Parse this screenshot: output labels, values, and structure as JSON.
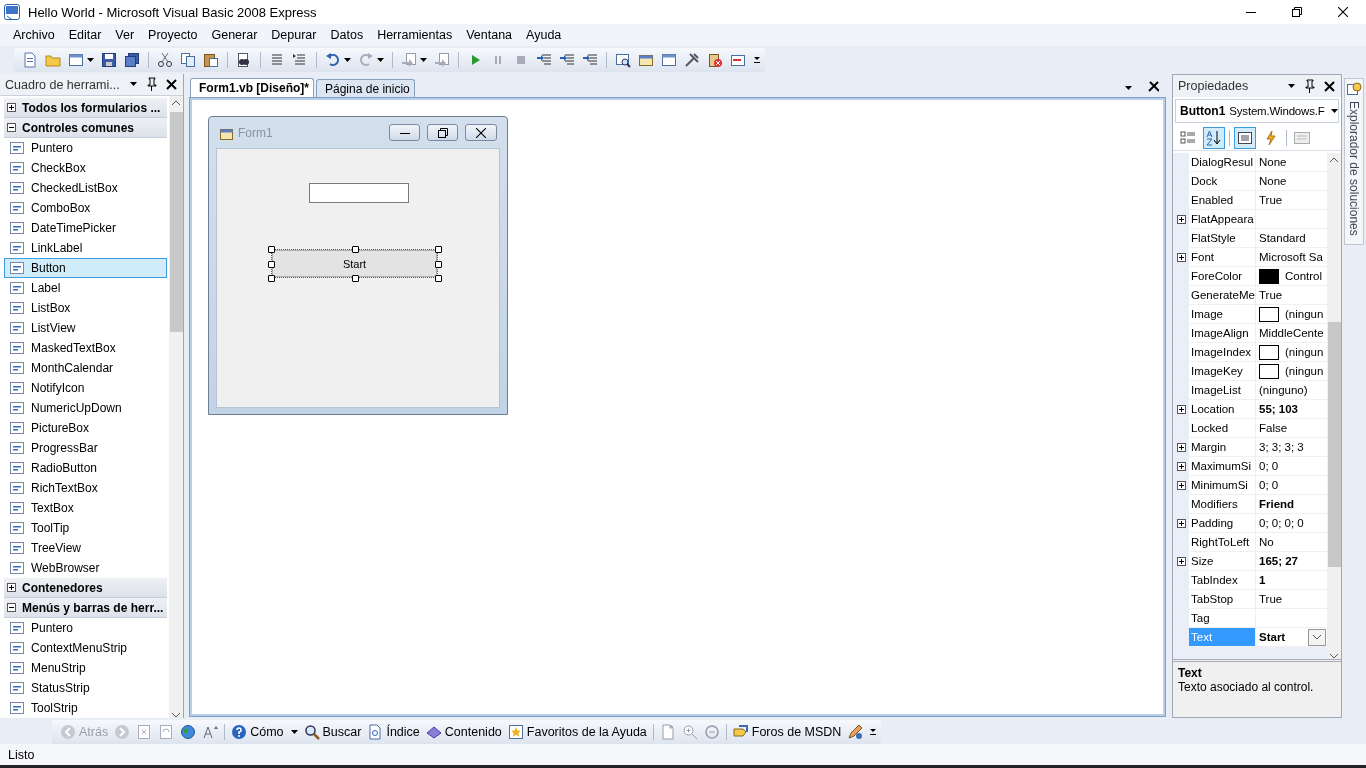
{
  "window": {
    "title": "Hello World - Microsoft Visual Basic 2008 Express"
  },
  "menu": [
    "Archivo",
    "Editar",
    "Ver",
    "Proyecto",
    "Generar",
    "Depurar",
    "Datos",
    "Herramientas",
    "Ventana",
    "Ayuda"
  ],
  "toolbox": {
    "title": "Cuadro de herrami...",
    "groups": [
      {
        "label": "Todos los formularios ...",
        "expanded": false
      },
      {
        "label": "Controles comunes",
        "expanded": true,
        "items": [
          {
            "label": "Puntero",
            "selected": false
          },
          {
            "label": "CheckBox",
            "selected": false
          },
          {
            "label": "CheckedListBox",
            "selected": false
          },
          {
            "label": "ComboBox",
            "selected": false
          },
          {
            "label": "DateTimePicker",
            "selected": false
          },
          {
            "label": "LinkLabel",
            "selected": false
          },
          {
            "label": "Button",
            "selected": true
          },
          {
            "label": "Label",
            "selected": false
          },
          {
            "label": "ListBox",
            "selected": false
          },
          {
            "label": "ListView",
            "selected": false
          },
          {
            "label": "MaskedTextBox",
            "selected": false
          },
          {
            "label": "MonthCalendar",
            "selected": false
          },
          {
            "label": "NotifyIcon",
            "selected": false
          },
          {
            "label": "NumericUpDown",
            "selected": false
          },
          {
            "label": "PictureBox",
            "selected": false
          },
          {
            "label": "ProgressBar",
            "selected": false
          },
          {
            "label": "RadioButton",
            "selected": false
          },
          {
            "label": "RichTextBox",
            "selected": false
          },
          {
            "label": "TextBox",
            "selected": false
          },
          {
            "label": "ToolTip",
            "selected": false
          },
          {
            "label": "TreeView",
            "selected": false
          },
          {
            "label": "WebBrowser",
            "selected": false
          }
        ]
      },
      {
        "label": "Contenedores",
        "expanded": false
      },
      {
        "label": "Menús y barras de herr...",
        "expanded": true,
        "items": [
          {
            "label": "Puntero",
            "selected": false
          },
          {
            "label": "ContextMenuStrip",
            "selected": false
          },
          {
            "label": "MenuStrip",
            "selected": false
          },
          {
            "label": "StatusStrip",
            "selected": false
          },
          {
            "label": "ToolStrip",
            "selected": false
          }
        ]
      }
    ]
  },
  "document": {
    "tabs": [
      {
        "label": "Form1.vb [Diseño]*",
        "selected": true
      },
      {
        "label": "Página de inicio",
        "selected": false
      }
    ],
    "form": {
      "title": "Form1",
      "button": {
        "label": "Start",
        "selected": true
      }
    }
  },
  "properties": {
    "title": "Propiedades",
    "object": {
      "name": "Button1",
      "type": "System.Windows.F"
    },
    "toolbar": {
      "sort_alphabetical": true,
      "show_events": false
    },
    "rows": [
      {
        "name": "DialogResul",
        "value": "None",
        "kind": "text",
        "expandable": false,
        "modified": false,
        "selected": false
      },
      {
        "name": "Dock",
        "value": "None",
        "kind": "text",
        "expandable": false,
        "modified": false,
        "selected": false
      },
      {
        "name": "Enabled",
        "value": "True",
        "kind": "text",
        "expandable": false,
        "modified": false,
        "selected": false
      },
      {
        "name": "FlatAppeara",
        "kind": "text",
        "expandable": true,
        "selected": false
      },
      {
        "name": "FlatStyle",
        "value": "Standard",
        "kind": "text",
        "expandable": false,
        "modified": false,
        "selected": false
      },
      {
        "name": "Font",
        "value": "Microsoft Sa",
        "kind": "text",
        "expandable": true,
        "modified": false,
        "selected": false
      },
      {
        "name": "ForeColor",
        "value": "Control",
        "kind": "swatch",
        "color": "#000000",
        "expandable": false,
        "modified": false,
        "selected": false
      },
      {
        "name": "GenerateMe",
        "value": "True",
        "kind": "text",
        "expandable": false,
        "modified": false,
        "selected": false
      },
      {
        "name": "Image",
        "value": "(ningun",
        "kind": "swatch",
        "color": "#ffffff",
        "expandable": false,
        "modified": false,
        "selected": false
      },
      {
        "name": "ImageAlign",
        "value": "MiddleCente",
        "kind": "text",
        "expandable": false,
        "modified": false,
        "selected": false
      },
      {
        "name": "ImageIndex",
        "value": "(ningun",
        "kind": "swatch",
        "color": "#ffffff",
        "expandable": false,
        "modified": false,
        "selected": false
      },
      {
        "name": "ImageKey",
        "value": "(ningun",
        "kind": "swatch",
        "color": "#ffffff",
        "expandable": false,
        "modified": false,
        "selected": false
      },
      {
        "name": "ImageList",
        "value": "(ninguno)",
        "kind": "text",
        "expandable": false,
        "modified": false,
        "selected": false
      },
      {
        "name": "Location",
        "value": "55; 103",
        "kind": "text",
        "expandable": true,
        "modified": true,
        "selected": false
      },
      {
        "name": "Locked",
        "value": "False",
        "kind": "text",
        "expandable": false,
        "modified": false,
        "selected": false
      },
      {
        "name": "Margin",
        "value": "3; 3; 3; 3",
        "kind": "text",
        "expandable": true,
        "modified": false,
        "selected": false
      },
      {
        "name": "MaximumSi",
        "value": "0; 0",
        "kind": "text",
        "expandable": true,
        "modified": false,
        "selected": false
      },
      {
        "name": "MinimumSi",
        "value": "0; 0",
        "kind": "text",
        "expandable": true,
        "modified": false,
        "selected": false
      },
      {
        "name": "Modifiers",
        "value": "Friend",
        "kind": "text",
        "expandable": false,
        "modified": true,
        "selected": false
      },
      {
        "name": "Padding",
        "value": "0; 0; 0; 0",
        "kind": "text",
        "expandable": true,
        "modified": false,
        "selected": false
      },
      {
        "name": "RightToLeft",
        "value": "No",
        "kind": "text",
        "expandable": false,
        "modified": false,
        "selected": false
      },
      {
        "name": "Size",
        "value": "165; 27",
        "kind": "text",
        "expandable": true,
        "modified": true,
        "selected": false
      },
      {
        "name": "TabIndex",
        "value": "1",
        "kind": "text",
        "expandable": false,
        "modified": true,
        "selected": false
      },
      {
        "name": "TabStop",
        "value": "True",
        "kind": "text",
        "expandable": false,
        "modified": false,
        "selected": false
      },
      {
        "name": "Tag",
        "kind": "text",
        "expandable": false,
        "selected": false
      },
      {
        "name": "Text",
        "value": "Start",
        "kind": "text",
        "expandable": false,
        "modified": true,
        "selected": true
      }
    ],
    "description": {
      "title": "Text",
      "text": "Texto asociado al control."
    }
  },
  "solution_tab": {
    "label": "Explorador de soluciones"
  },
  "help_toolbar": {
    "buttons": [
      {
        "label": "Atrás",
        "disabled": true
      },
      {
        "label": "Cómo",
        "disabled": false
      },
      {
        "label": "Buscar",
        "disabled": false
      },
      {
        "label": "Índice",
        "disabled": false
      },
      {
        "label": "Contenido",
        "disabled": false
      },
      {
        "label": "Favoritos de la Ayuda",
        "disabled": false
      },
      {
        "label": "Foros de MSDN",
        "disabled": false
      }
    ]
  },
  "status_bar": {
    "text": "Listo"
  }
}
